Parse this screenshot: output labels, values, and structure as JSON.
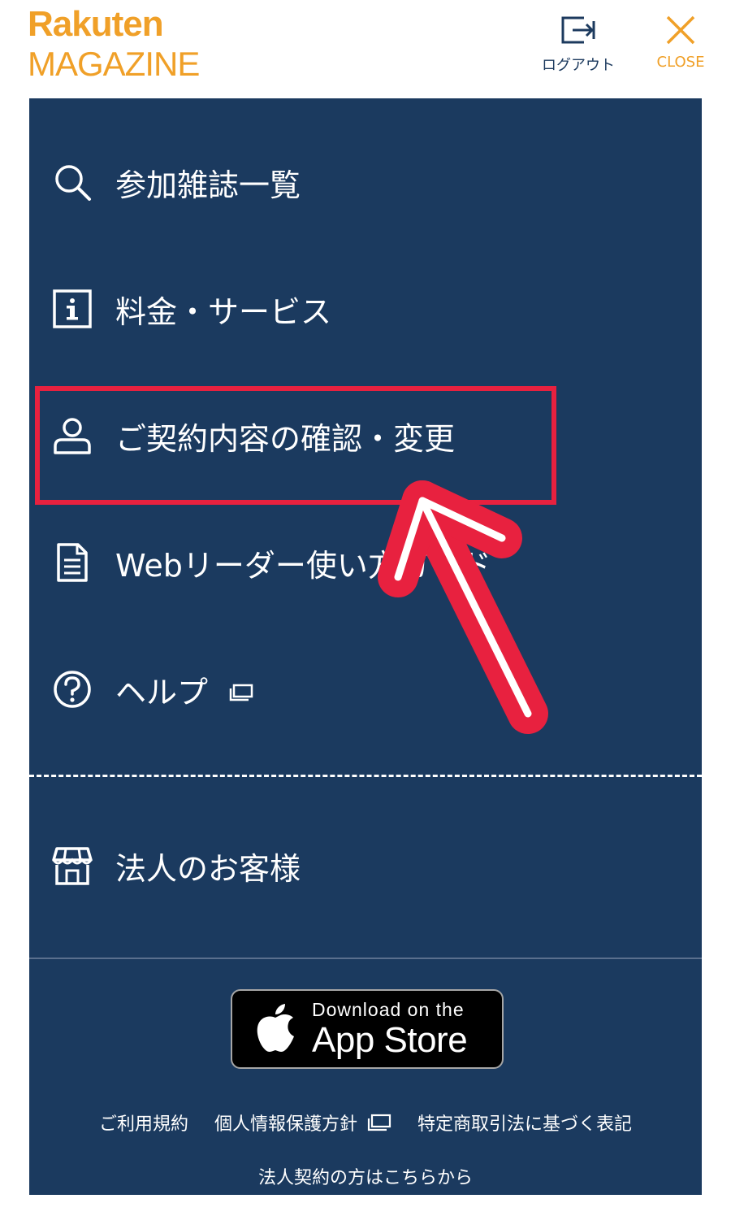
{
  "header": {
    "logo_line1": "Rakuten",
    "logo_line2": "MAGAZINE",
    "logout_label": "ログアウト",
    "close_label": "CLOSE"
  },
  "menu": {
    "items": [
      {
        "label": "参加雑誌一覧",
        "icon": "search-icon"
      },
      {
        "label": "料金・サービス",
        "icon": "info-icon"
      },
      {
        "label": "ご契約内容の確認・変更",
        "icon": "user-icon"
      },
      {
        "label": "Webリーダー使い方ガイド",
        "icon": "document-icon"
      },
      {
        "label": "ヘルプ",
        "icon": "help-icon"
      }
    ],
    "corporate": {
      "label": "法人のお客様",
      "icon": "store-icon"
    }
  },
  "appstore": {
    "small": "Download on the",
    "big": "App Store"
  },
  "footer": {
    "terms": "ご利用規約",
    "privacy": "個人情報保護方針",
    "commerce": "特定商取引法に基づく表記",
    "corporate_contract": "法人契約の方はこちらから"
  },
  "colors": {
    "brand_orange": "#f0a028",
    "panel_navy": "#1b3a5f",
    "highlight_red": "#e8213f"
  }
}
